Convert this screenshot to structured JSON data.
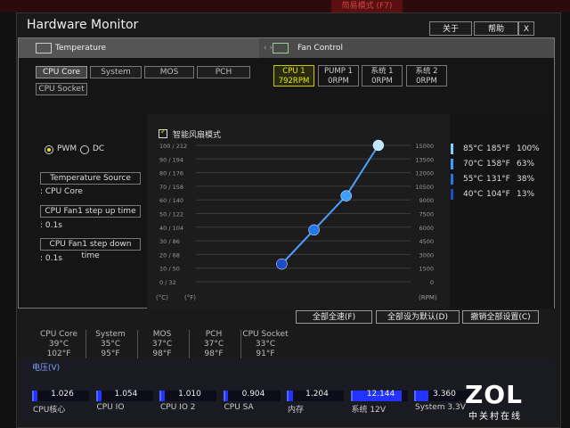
{
  "window": {
    "title": "Hardware Monitor",
    "bg_tab_text": "简易模式 (F7)",
    "buttons": {
      "about": "关于",
      "help": "帮助",
      "close": "X"
    }
  },
  "tabs": {
    "temperature": "Temperature",
    "fan_control": "Fan Control"
  },
  "sensors": [
    "CPU Core",
    "System",
    "MOS",
    "PCH",
    "CPU Socket"
  ],
  "fans": [
    {
      "name": "CPU 1",
      "rpm": "792RPM"
    },
    {
      "name": "PUMP 1",
      "rpm": "0RPM"
    },
    {
      "name": "系统 1",
      "rpm": "0RPM"
    },
    {
      "name": "系统 2",
      "rpm": "0RPM"
    }
  ],
  "mode": {
    "pwm": "PWM",
    "dc": "DC",
    "selected": "PWM"
  },
  "settings": {
    "temp_source_label": "Temperature Source",
    "temp_source_value": ": CPU Core",
    "step_up_label": "CPU Fan1 step up time",
    "step_up_value": ": 0.1s",
    "step_down_label": "CPU Fan1 step down time",
    "step_down_value": ": 0.1s"
  },
  "smart_fan_label": "智能风扇模式",
  "chart_data": {
    "type": "line",
    "y_left_ticks": [
      "100 / 212",
      "90 / 194",
      "80 / 176",
      "70 / 158",
      "60 / 140",
      "50 / 122",
      "40 / 104",
      "30 / 86",
      "20 / 68",
      "10 / 50",
      "0 / 32"
    ],
    "y_right_ticks": [
      "15000",
      "13500",
      "12000",
      "10500",
      "9000",
      "7500",
      "6000",
      "4500",
      "3000",
      "1500",
      "0"
    ],
    "xlabel_c": "(°C)",
    "xlabel_f": "(°F)",
    "rpm_label": "(RPM)",
    "points": [
      {
        "temp_c": 40,
        "temp_f": 104,
        "pct": 13
      },
      {
        "temp_c": 55,
        "temp_f": 131,
        "pct": 38
      },
      {
        "temp_c": 70,
        "temp_f": 158,
        "pct": 63
      },
      {
        "temp_c": 85,
        "temp_f": 185,
        "pct": 100
      }
    ],
    "ylim": [
      0,
      100
    ]
  },
  "legend": [
    {
      "c": "85°C",
      "f": "185°F",
      "pct": "100%",
      "color": "#7fd0ff"
    },
    {
      "c": "70°C",
      "f": "158°F",
      "pct": "63%",
      "color": "#3aa0ff"
    },
    {
      "c": "55°C",
      "f": "131°F",
      "pct": "38%",
      "color": "#2277ee"
    },
    {
      "c": "40°C",
      "f": "104°F",
      "pct": "13%",
      "color": "#1a4ccc"
    }
  ],
  "actions": {
    "full_speed": "全部全速(F)",
    "set_default": "全部设为默认(D)",
    "undo_all": "撤销全部设置(C)"
  },
  "temperatures": [
    {
      "name": "CPU Core",
      "c": "39°C",
      "f": "102°F"
    },
    {
      "name": "System",
      "c": "35°C",
      "f": "95°F"
    },
    {
      "name": "MOS",
      "c": "37°C",
      "f": "98°F"
    },
    {
      "name": "PCH",
      "c": "37°C",
      "f": "98°F"
    },
    {
      "name": "CPU Socket",
      "c": "33°C",
      "f": "91°F"
    }
  ],
  "voltage": {
    "title": "电压(V)",
    "items": [
      {
        "name": "CPU核心",
        "value": "1.026",
        "fill": 0.07
      },
      {
        "name": "CPU IO",
        "value": "1.054",
        "fill": 0.07
      },
      {
        "name": "CPU IO 2",
        "value": "1.010",
        "fill": 0.07
      },
      {
        "name": "CPU SA",
        "value": "0.904",
        "fill": 0.06
      },
      {
        "name": "内存",
        "value": "1.204",
        "fill": 0.08
      },
      {
        "name": "系统 12V",
        "value": "12.144",
        "fill": 0.9
      },
      {
        "name": "System 3.3V",
        "value": "3.360",
        "fill": 0.22
      }
    ]
  },
  "watermark": {
    "logo": "ZOL",
    "sub": "中关村在线"
  }
}
